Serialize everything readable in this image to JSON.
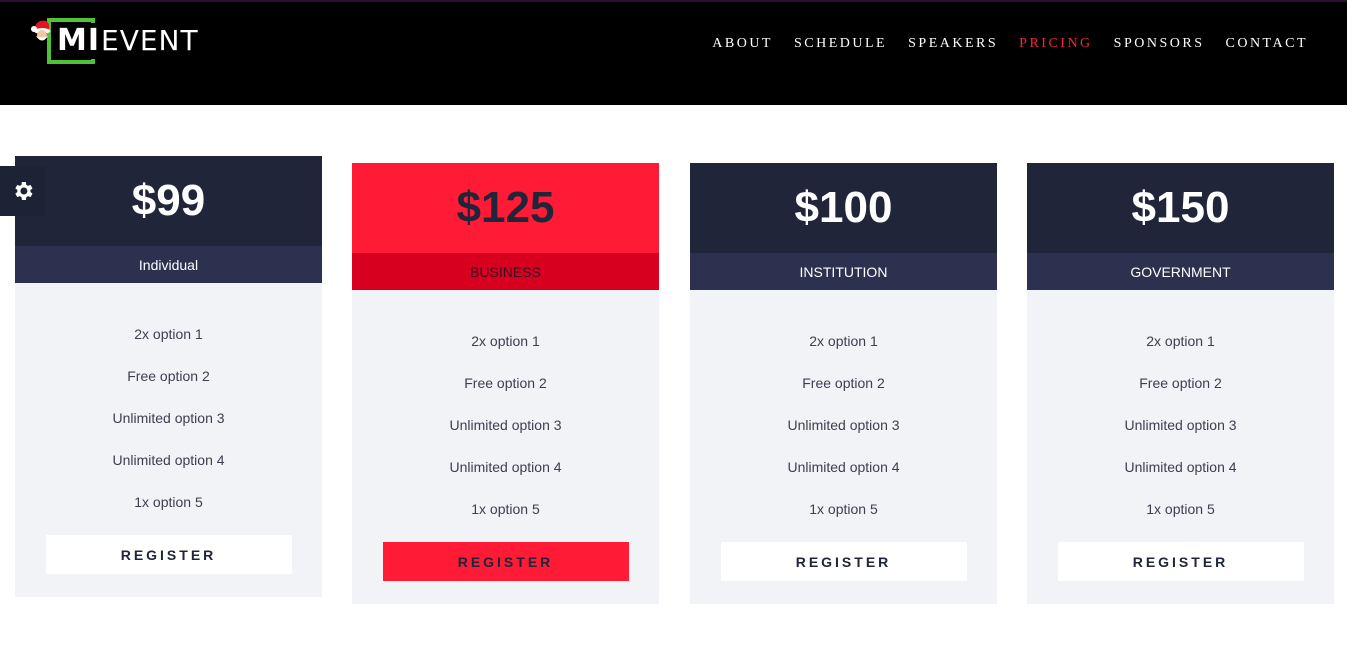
{
  "brand": {
    "logo_bold": "MI",
    "logo_light": "EVENT",
    "accent_green": "#4fc23a",
    "accent_red": "#ff1f3a"
  },
  "nav": [
    {
      "label": "ABOUT",
      "active": false
    },
    {
      "label": "SCHEDULE",
      "active": false
    },
    {
      "label": "SPEAKERS",
      "active": false
    },
    {
      "label": "PRICING",
      "active": true
    },
    {
      "label": "SPONSORS",
      "active": false
    },
    {
      "label": "CONTACT",
      "active": false
    }
  ],
  "settings": {
    "icon": "gear-icon"
  },
  "plans": [
    {
      "price": "$99",
      "name": "Individual",
      "featured": false,
      "options": [
        "2x option 1",
        "Free option 2",
        "Unlimited option 3",
        "Unlimited option 4",
        "1x option 5"
      ],
      "button": "REGISTER"
    },
    {
      "price": "$125",
      "name": "BUSINESS",
      "featured": true,
      "options": [
        "2x option 1",
        "Free option 2",
        "Unlimited option 3",
        "Unlimited option 4",
        "1x option 5"
      ],
      "button": "REGISTER"
    },
    {
      "price": "$100",
      "name": "INSTITUTION",
      "featured": false,
      "options": [
        "2x option 1",
        "Free option 2",
        "Unlimited option 3",
        "Unlimited option 4",
        "1x option 5"
      ],
      "button": "REGISTER"
    },
    {
      "price": "$150",
      "name": "GOVERNMENT",
      "featured": false,
      "options": [
        "2x option 1",
        "Free option 2",
        "Unlimited option 3",
        "Unlimited option 4",
        "1x option 5"
      ],
      "button": "REGISTER"
    }
  ]
}
